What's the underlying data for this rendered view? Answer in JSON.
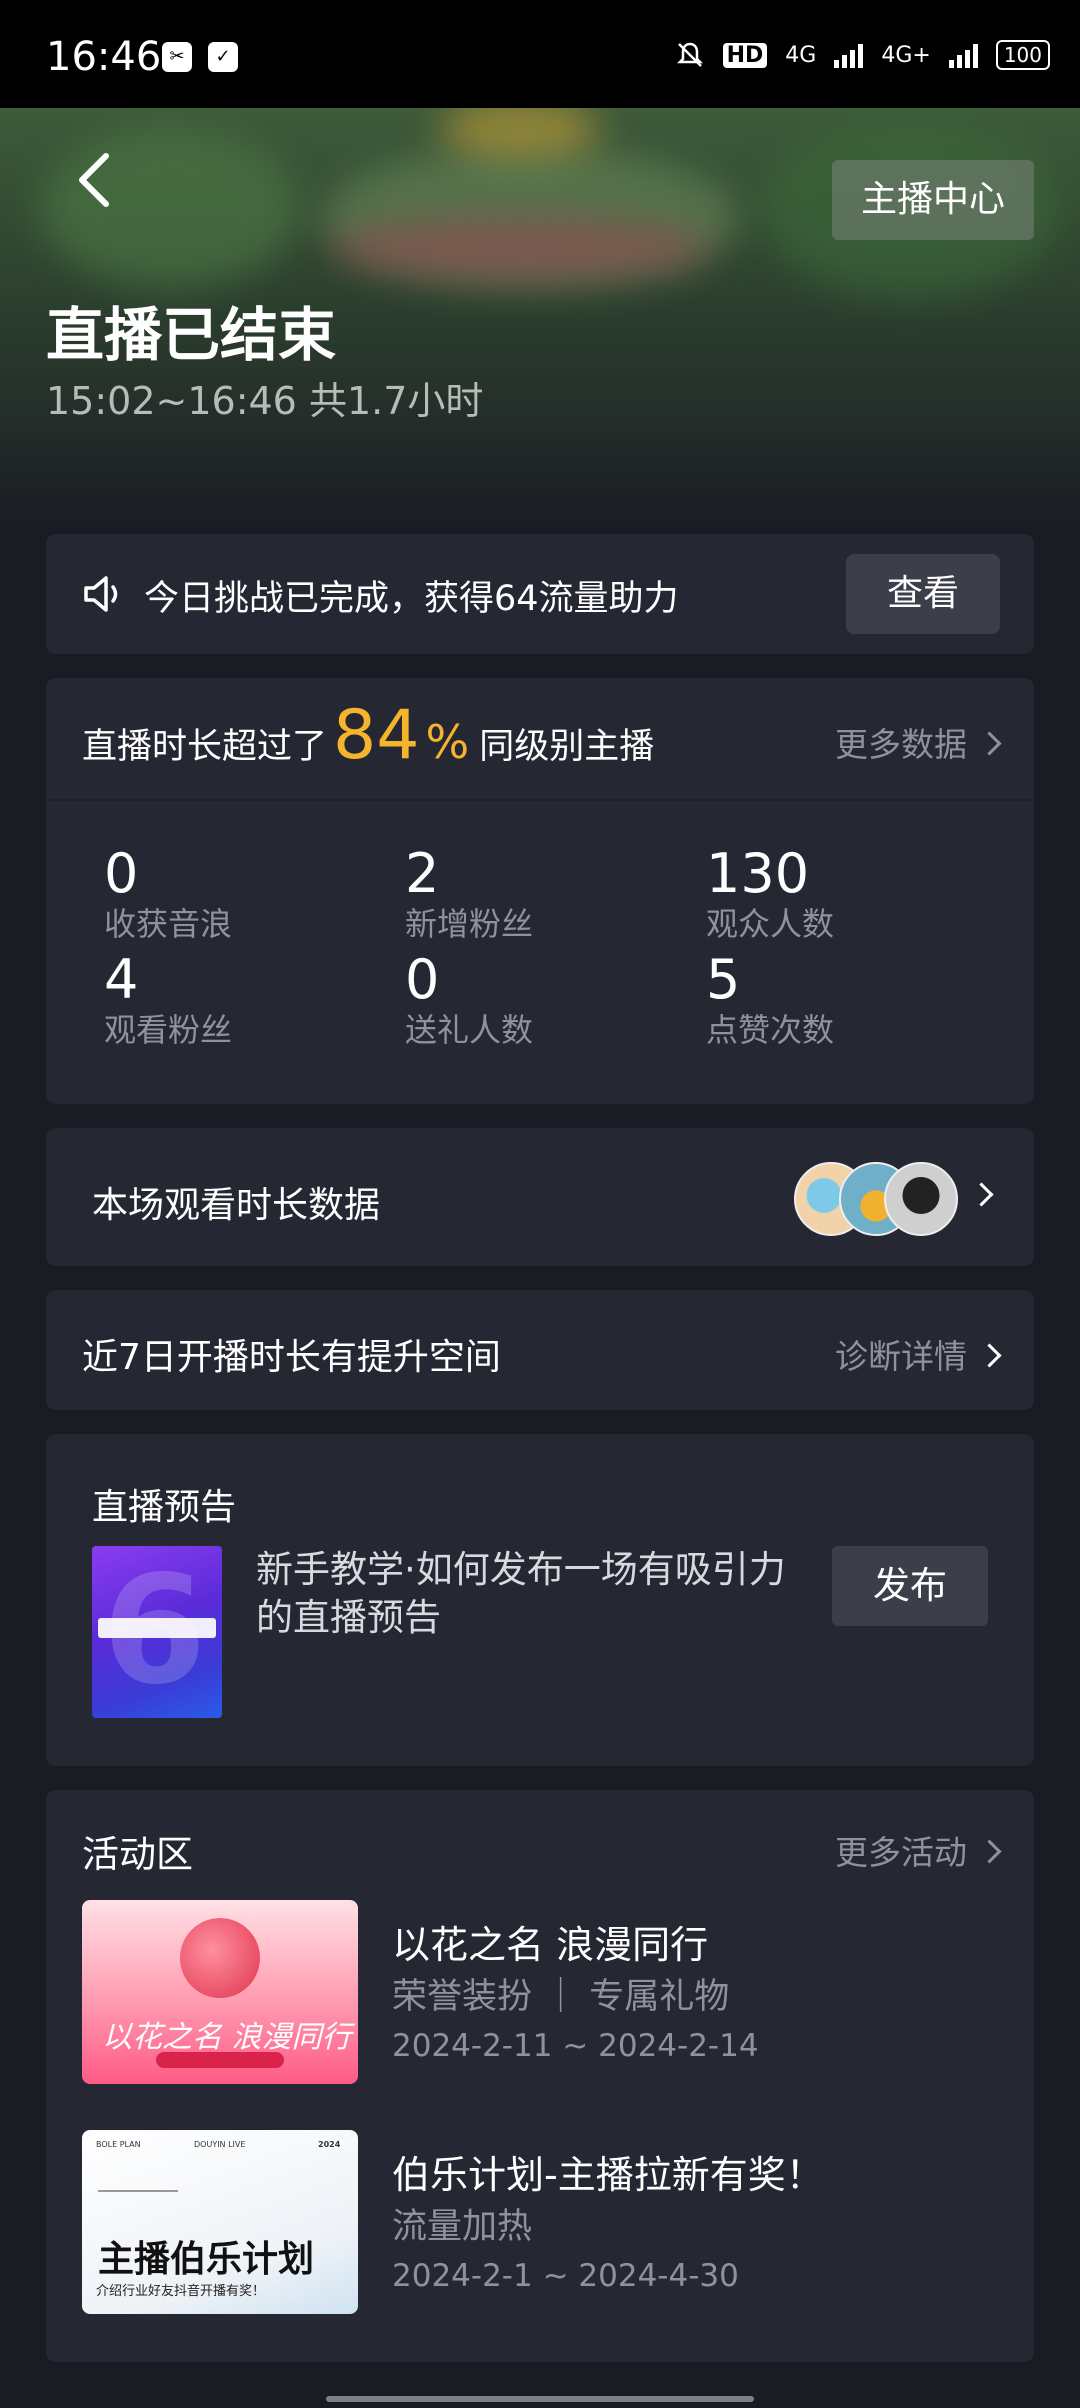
{
  "status_bar": {
    "time": "16:46",
    "hd_label": "HD",
    "network_1": "4G",
    "network_2": "4G+",
    "battery": "100"
  },
  "header": {
    "back_icon": "chevron-left-icon",
    "anchor_center_label": "主播中心",
    "title": "直播已结束",
    "session_time": "15:02~16:46 共1.7小时"
  },
  "challenge": {
    "icon": "speaker-icon",
    "text": "今日挑战已完成，获得64流量助力",
    "button_label": "查看"
  },
  "stats": {
    "headline_prefix": "直播时长超过了",
    "headline_percent": "84",
    "headline_percent_sign": "%",
    "headline_suffix": "同级别主播",
    "more_label": "更多数据",
    "items": [
      {
        "value": "0",
        "label": "收获音浪"
      },
      {
        "value": "2",
        "label": "新增粉丝"
      },
      {
        "value": "130",
        "label": "观众人数"
      },
      {
        "value": "4",
        "label": "观看粉丝"
      },
      {
        "value": "0",
        "label": "送礼人数"
      },
      {
        "value": "5",
        "label": "点赞次数"
      }
    ]
  },
  "watch_duration": {
    "title": "本场观看时长数据"
  },
  "diagnosis": {
    "title": "近7日开播时长有提升空间",
    "link_label": "诊断详情"
  },
  "preview": {
    "title": "直播预告",
    "description": "新手教学·如何发布一场有吸引力的直播预告",
    "publish_label": "发布"
  },
  "activities": {
    "title": "活动区",
    "more_label": "更多活动",
    "items": [
      {
        "name": "以花之名 浪漫同行",
        "tags": "荣誉装扮 ｜ 专属礼物",
        "date": "2024-2-11 ~ 2024-2-14"
      },
      {
        "name": "伯乐计划-主播拉新有奖！",
        "tags": "流量加热",
        "date": "2024-2-1 ~ 2024-4-30"
      }
    ]
  },
  "thumb_text": {
    "act1_script": "以花之名 浪漫同行",
    "act2_title": "主播伯乐计划",
    "act2_sub": "介绍行业好友抖音开播有奖！",
    "act2_top_left": "BOLE PLAN",
    "act2_top_mid": "DOUYIN LIVE",
    "act2_top_right": "2024"
  },
  "colors": {
    "accent_orange": "#f5b42c",
    "card_bg": "#252833",
    "page_bg": "#1a1c24",
    "muted_text": "#8f929c"
  }
}
